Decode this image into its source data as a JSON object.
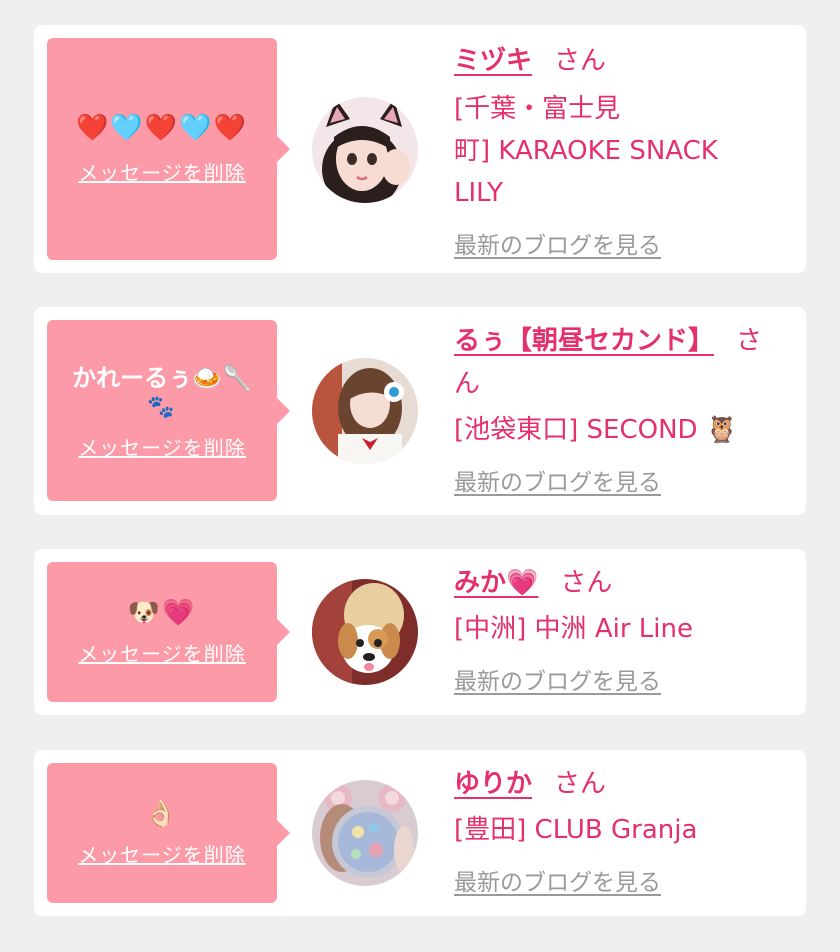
{
  "cards": [
    {
      "message": "",
      "message_emoji": "❤️🩵❤️🩵❤️",
      "delete_label": "メッセージを削除",
      "name": "ミヅキ",
      "suffix": "さん",
      "shop": "[千葉・富士見町] KARAOKE SNACK LILY",
      "shop_line1": "[千葉・富士見",
      "shop_line2": "町] KARAOKE SNACK",
      "shop_line3": "LILY",
      "blog_link": "最新のブログを見る",
      "avatar_icon": "cat-ear-girl-avatar-icon"
    },
    {
      "message": "かれーるぅ🍛🥄",
      "message_emoji": "🐾",
      "delete_label": "メッセージを削除",
      "name": "るぅ【朝昼セカンド】",
      "suffix": "さん",
      "shop": "[池袋東口] SECOND 🦉",
      "blog_link": "最新のブログを見る",
      "avatar_icon": "uniform-girl-avatar-icon"
    },
    {
      "message": "",
      "message_emoji": "🐶💗",
      "delete_label": "メッセージを削除",
      "name": "みか💗",
      "suffix": "さん",
      "shop": "[中洲] 中洲 Air Line",
      "blog_link": "最新のブログを見る",
      "avatar_icon": "dog-face-avatar-icon"
    },
    {
      "message": "",
      "message_emoji": "👌🏻",
      "delete_label": "メッセージを削除",
      "name": "ゆりか",
      "suffix": "さん",
      "shop": "[豊田] CLUB Granja",
      "blog_link": "最新のブログを見る",
      "avatar_icon": "mirror-avatar-icon"
    }
  ],
  "colors": {
    "background": "#efefef",
    "card": "#ffffff",
    "bubble": "#fd9aa7",
    "accent": "#e4306b",
    "link_gray": "#9a9a9a"
  }
}
